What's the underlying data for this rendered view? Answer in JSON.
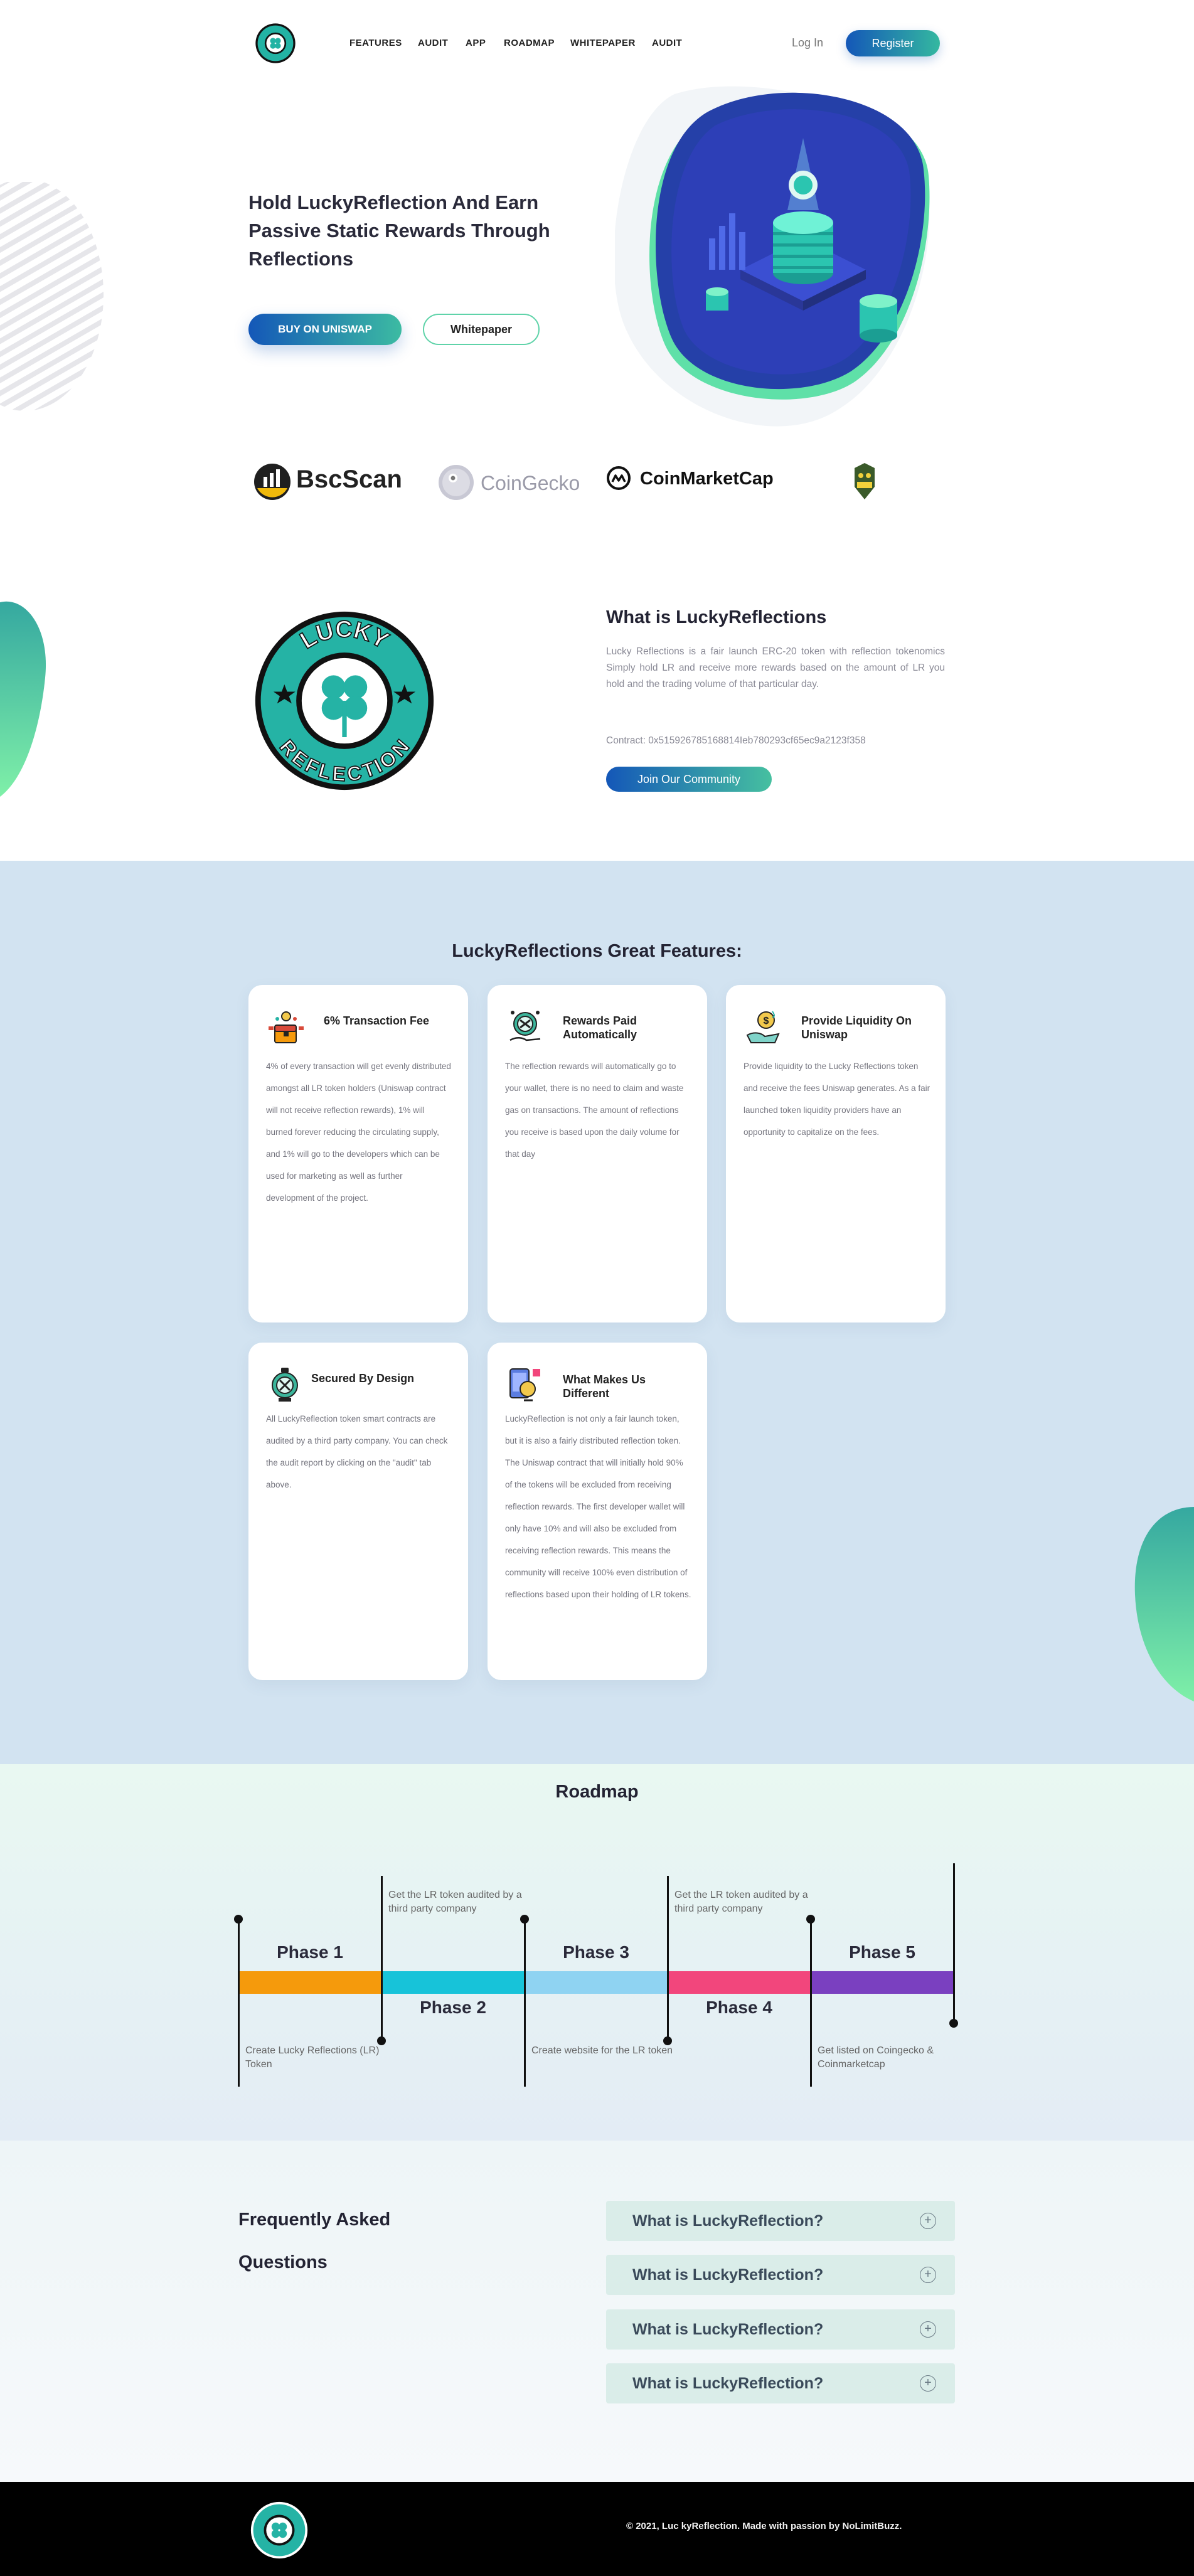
{
  "nav": {
    "links": [
      "FEATURES",
      "AUDIT",
      "APP",
      "ROADMAP",
      "WHITEPAPER",
      "AUDIT"
    ],
    "login": "Log In",
    "register": "Register"
  },
  "hero": {
    "title": "Hold LuckyReflection And Earn Passive Static Rewards Through Reflections",
    "buy_button": "BUY ON UNISWAP",
    "whitepaper_button": "Whitepaper"
  },
  "partners": {
    "bscscan": "BscScan",
    "coingecko": "CoinGecko",
    "coinmarketcap": "CoinMarketCap",
    "nolimitbuzz": "NOLIMIT BUZZ"
  },
  "logo": {
    "top_text": "LUCKY",
    "bottom_text": "REFLECTION"
  },
  "about": {
    "heading": "What is LuckyReflections",
    "paragraph": "Lucky Reflections is a fair launch ERC-20 token with reflection tokenomics Simply hold LR and receive more rewards based on the amount of LR you hold and the trading volume of that particular day.",
    "contract": "Contract: 0x515926785168814Ieb780293cf65ec9a2123f358",
    "join_button": "Join Our Community"
  },
  "features": {
    "heading": "LuckyReflections Great Features:",
    "cards": [
      {
        "title": "6% Transaction Fee",
        "text": "4% of every transaction will get evenly distributed amongst all LR token holders (Uniswap contract will not receive reflection rewards), 1% will burned forever reducing the circulating supply, and 1% will go to the developers which can be used for marketing as well as further development of the project."
      },
      {
        "title": "Rewards Paid Automatically",
        "text": "The reflection rewards will automatically go to your wallet, there is no need to claim and waste gas on transactions. The amount of reflections you receive is based upon the daily volume for that day"
      },
      {
        "title": "Provide Liquidity On Uniswap",
        "text": "Provide liquidity to the Lucky Reflections token and receive the fees Uniswap generates. As a fair launched token liquidity providers have an opportunity to capitalize on the fees."
      },
      {
        "title": "Secured By Design",
        "text": "All LuckyReflection token smart contracts are audited by a third party company. You can check the audit report by clicking on the \"audit\" tab above."
      },
      {
        "title": "What Makes Us Different",
        "text": "LuckyReflection is not only a fair launch token, but it is also a fairly distributed reflection token. The Uniswap contract that will initially hold 90% of the tokens will be excluded from receiving reflection rewards. The first developer wallet will only have 10% and will also be excluded from receiving reflection rewards. This means the community will receive 100% even distribution of reflections based upon their holding of LR tokens."
      }
    ]
  },
  "roadmap": {
    "heading": "Roadmap",
    "phases": [
      {
        "label": "Phase 1",
        "color": "#f59a0c",
        "note": "Create Lucky Reflections (LR) Token"
      },
      {
        "label": "Phase 2",
        "color": "#17c3d9",
        "note": "Get the LR token audited by a third party company"
      },
      {
        "label": "Phase 3",
        "color": "#8fd3f2",
        "note": "Create website for the LR token"
      },
      {
        "label": "Phase 4",
        "color": "#f2467c",
        "note": "Get the LR token audited by a third party company"
      },
      {
        "label": "Phase 5",
        "color": "#7a40c0",
        "note": "Get listed on Coingecko & Coinmarketcap"
      }
    ]
  },
  "faq": {
    "heading_line1": "Frequently Asked",
    "heading_line2": "Questions",
    "questions": [
      "What is LuckyReflection?",
      "What is LuckyReflection?",
      "What is LuckyReflection?",
      "What is LuckyReflection?"
    ]
  },
  "footer": {
    "copyright": "© 2021, Luc kyReflection. Made with passion by NoLimitBuzz."
  }
}
